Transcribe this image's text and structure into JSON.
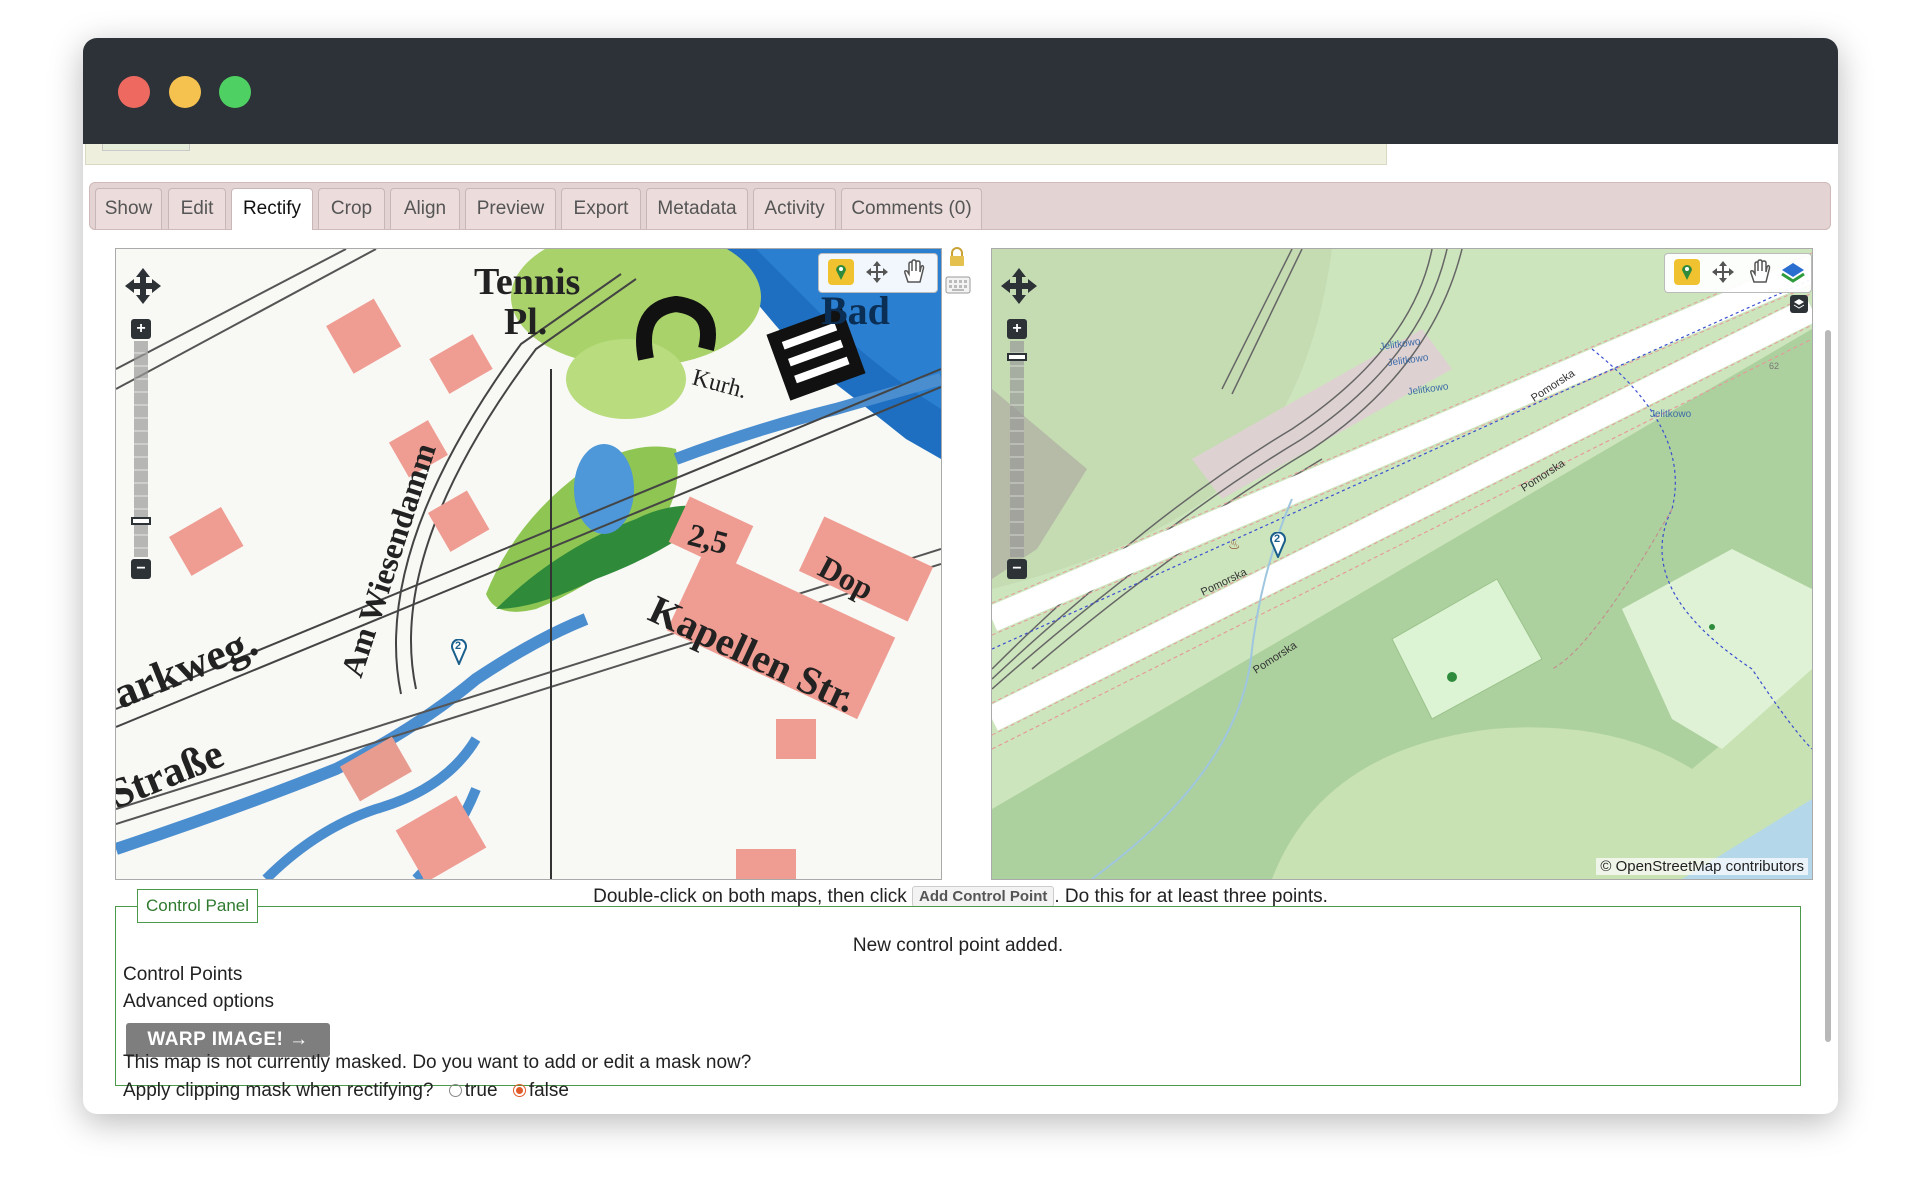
{
  "tabs": [
    {
      "label": "Show"
    },
    {
      "label": "Edit"
    },
    {
      "label": "Rectify",
      "active": true
    },
    {
      "label": "Crop"
    },
    {
      "label": "Align"
    },
    {
      "label": "Preview"
    },
    {
      "label": "Export"
    },
    {
      "label": "Metadata"
    },
    {
      "label": "Activity"
    },
    {
      "label": "Comments (0)"
    }
  ],
  "left_map": {
    "labels": {
      "tennis": "Tennis",
      "pl": "Pl.",
      "bad": "Bad",
      "wiesendamm": "Am Wiesendamm",
      "kurh": "Kurh.",
      "num": "2,5",
      "dop": "Dop",
      "kapellen": "Kapellen Str.",
      "parkweg": "Parkweg.",
      "strasse": "Straße"
    },
    "marker_label": "2",
    "tools": [
      "place-point-icon",
      "move-icon",
      "pan-hand-icon"
    ]
  },
  "right_map": {
    "labels": {
      "jelitkowo1": "Jelitkowo",
      "jelitkowo2": "Jelitkowo",
      "jelitkowo3": "Jelitkowo",
      "jelitkowo4": "Jelitkowo",
      "pomorska1": "Pomorska",
      "pomorska2": "Pomorska",
      "pomorska3": "Pomorska",
      "pomorska4": "Pomorska",
      "num62": "62"
    },
    "marker_label": "2",
    "attribution": "© OpenStreetMap contributors",
    "tools": [
      "place-point-icon",
      "move-icon",
      "pan-hand-icon",
      "layers-icon"
    ]
  },
  "instructions": {
    "before": "Double-click on both maps, then click",
    "button": "Add Control Point",
    "after": ". Do this for at least three points."
  },
  "control_panel": {
    "legend": "Control Panel",
    "message": "New control point added.",
    "control_points": "Control Points",
    "advanced": "Advanced options",
    "warp_button": "WARP IMAGE! →",
    "mask_note": "This map is not currently masked. Do you want to add or edit a mask now?",
    "clip_question": "Apply clipping mask when rectifying?",
    "opt_true": "true",
    "opt_false": "false",
    "selected": "false"
  },
  "colors": {
    "titlebar": "#2c3238",
    "tabbar": "#e4d3d3",
    "panel_border": "#4a9a4a",
    "warp_button": "#7e7e7e",
    "radio_selected": "#e05a2a"
  }
}
